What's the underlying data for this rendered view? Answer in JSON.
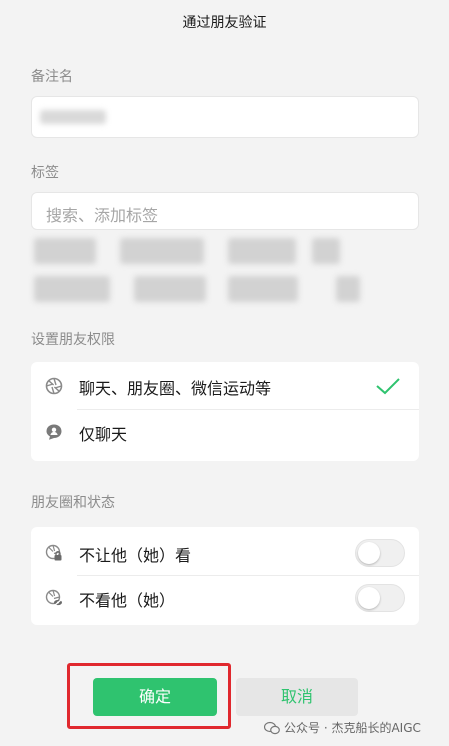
{
  "title": "通过朋友验证",
  "remark": {
    "label": "备注名",
    "value": ""
  },
  "tags": {
    "label": "标签",
    "placeholder": "搜索、添加标签"
  },
  "permissions": {
    "label": "设置朋友权限",
    "options": [
      {
        "label": "聊天、朋友圈、微信运动等",
        "icon": "aperture-icon",
        "selected": true
      },
      {
        "label": "仅聊天",
        "icon": "chat-user-icon",
        "selected": false
      }
    ]
  },
  "moments": {
    "label": "朋友圈和状态",
    "options": [
      {
        "label": "不让他（她）看",
        "icon": "moments-lock-icon",
        "enabled": false
      },
      {
        "label": "不看他（她）",
        "icon": "moments-hide-icon",
        "enabled": false
      }
    ]
  },
  "buttons": {
    "confirm": "确定",
    "cancel": "取消"
  },
  "watermark": "公众号 · 杰克船长的AIGC",
  "colors": {
    "accent": "#2fc36f",
    "highlight": "#e0282e"
  }
}
